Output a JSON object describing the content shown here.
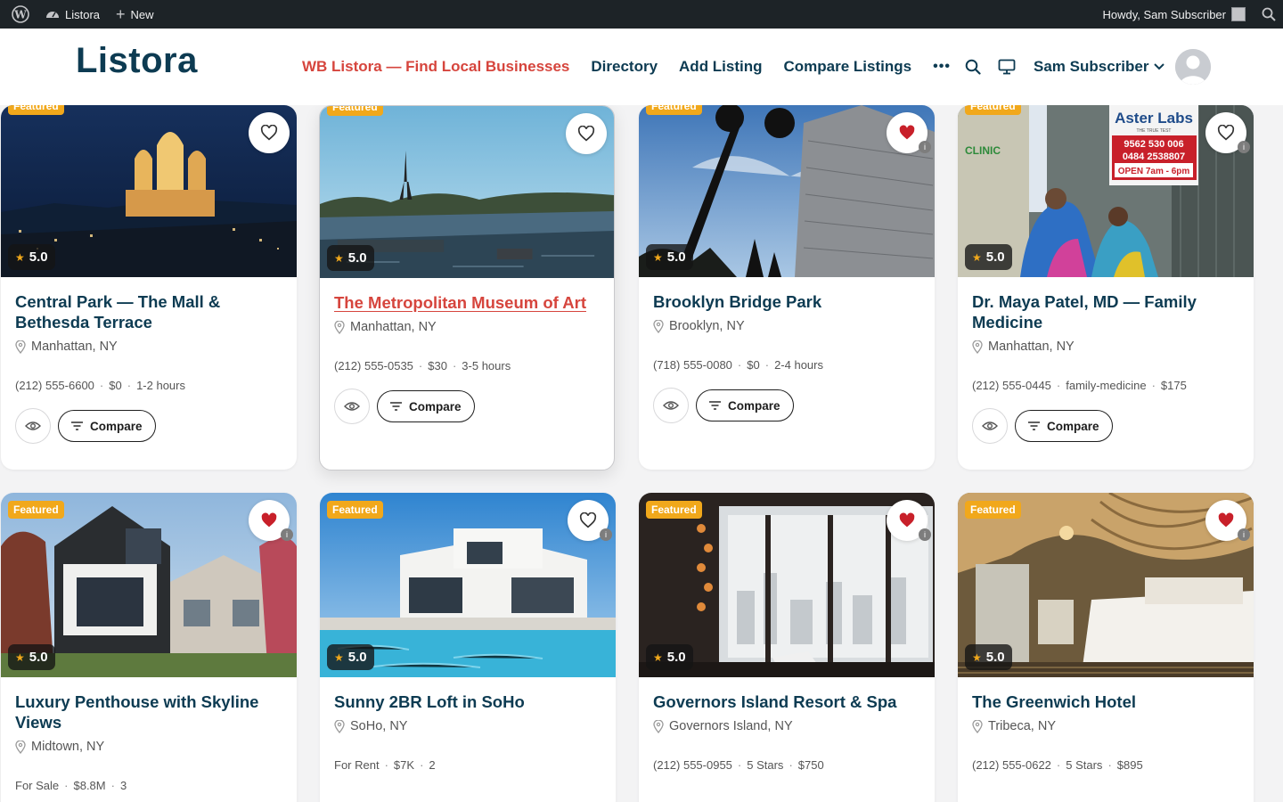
{
  "adminbar": {
    "site_name": "Listora",
    "new_label": "New",
    "howdy": "Howdy, Sam Subscriber"
  },
  "header": {
    "logo": "Listora",
    "nav": [
      "WB Listora — Find Local Businesses",
      "Directory",
      "Add Listing",
      "Compare Listings"
    ],
    "more": "•••",
    "user": "Sam Subscriber"
  },
  "labels": {
    "featured": "Featured",
    "compare": "Compare",
    "star": "★"
  },
  "listings": [
    {
      "title": "Central Park — The Mall & Bethesda Terrace",
      "location": "Manhattan, NY",
      "rating": "5.0",
      "meta": [
        "(212) 555-6600",
        "$0",
        "1-2 hours"
      ],
      "favorited": false
    },
    {
      "title": "The Metropolitan Museum of Art",
      "location": "Manhattan, NY",
      "rating": "5.0",
      "meta": [
        "(212) 555-0535",
        "$30",
        "3-5 hours"
      ],
      "favorited": false
    },
    {
      "title": "Brooklyn Bridge Park",
      "location": "Brooklyn, NY",
      "rating": "5.0",
      "meta": [
        "(718) 555-0080",
        "$0",
        "2-4 hours"
      ],
      "favorited": true
    },
    {
      "title": "Dr. Maya Patel, MD — Family Medicine",
      "location": "Manhattan, NY",
      "rating": "5.0",
      "meta": [
        "(212) 555-0445",
        "family-medicine",
        "$175"
      ],
      "favorited": false
    },
    {
      "title": "Luxury Penthouse with Skyline Views",
      "location": "Midtown, NY",
      "rating": "5.0",
      "meta": [
        "For Sale",
        "$8.8M",
        "3"
      ],
      "favorited": true
    },
    {
      "title": "Sunny 2BR Loft in SoHo",
      "location": "SoHo, NY",
      "rating": "5.0",
      "meta": [
        "For Rent",
        "$7K",
        "2"
      ],
      "favorited": false
    },
    {
      "title": "Governors Island Resort & Spa",
      "location": "Governors Island, NY",
      "rating": "5.0",
      "meta": [
        "(212) 555-0955",
        "5 Stars",
        "$750"
      ],
      "favorited": true
    },
    {
      "title": "The Greenwich Hotel",
      "location": "Tribeca, NY",
      "rating": "5.0",
      "meta": [
        "(212) 555-0622",
        "5 Stars",
        "$895"
      ],
      "favorited": true
    }
  ],
  "signage": {
    "brand": "Aster Labs",
    "tagline": "THE TRUE TEST",
    "phone1": "9562 530 006",
    "phone2": "0484 2538807",
    "open": "OPEN 7am - 6pm",
    "clinic": "CLINIC"
  }
}
